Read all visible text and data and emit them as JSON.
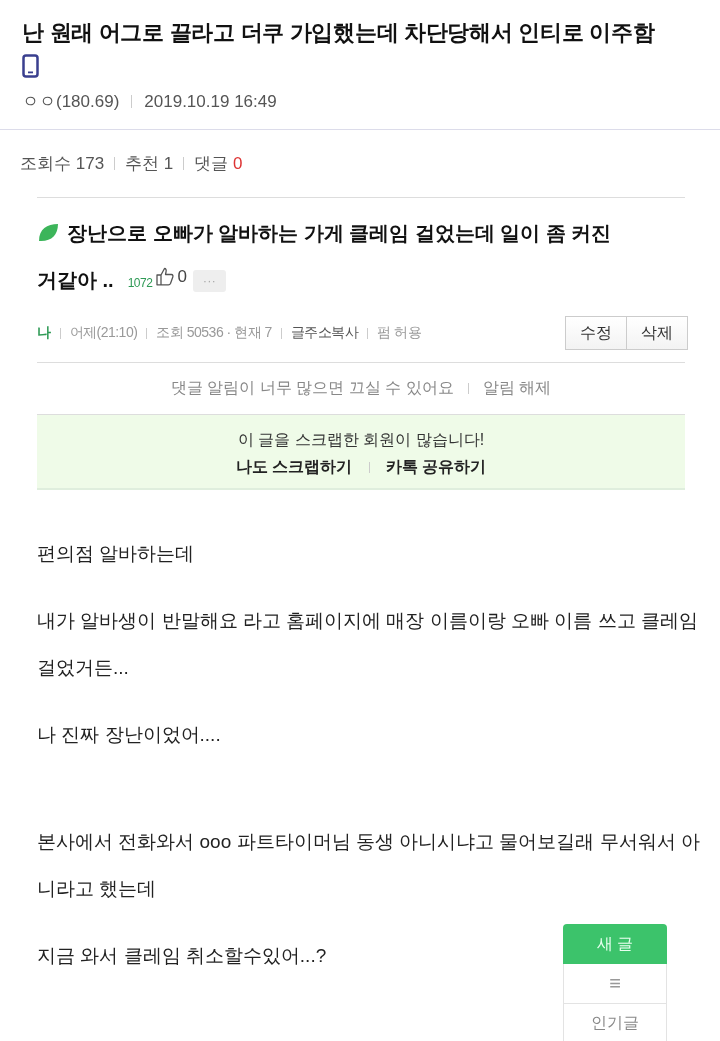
{
  "post": {
    "title": "난 원래 어그로 끌라고 더쿠 가입했는데 차단당해서 인티로 이주함",
    "author": "ㅇㅇ(180.69)",
    "date": "2019.10.19 16:49",
    "stats": [
      {
        "label": "조회수",
        "value": "173",
        "highlight": false
      },
      {
        "label": "추천",
        "value": "1",
        "highlight": false
      },
      {
        "label": "댓글",
        "value": "0",
        "highlight": true
      }
    ]
  },
  "embedded": {
    "title_lines": [
      "장난으로 오빠가 알바하는 가게 클레임 걸었는데 일이 좀 커진",
      "거같아 .."
    ],
    "count": "1072",
    "likes": "0",
    "more": "···",
    "meta": [
      {
        "text": "나",
        "kind": "author"
      },
      {
        "text": "어제(21:10)",
        "kind": "plain"
      },
      {
        "text": "조회 50536 · 현재 7",
        "kind": "plain"
      },
      {
        "text": "글주소복사",
        "kind": "link"
      },
      {
        "text": "펌 허용",
        "kind": "plain"
      }
    ],
    "buttons": [
      "수정",
      "삭제"
    ],
    "notice": {
      "text": "댓글 알림이 너무 많으면 끄실 수 있어요",
      "action": "알림 해제"
    },
    "scrap": {
      "message": "이 글을 스크랩한 회원이 많습니다!",
      "actions": [
        "나도 스크랩하기",
        "카톡 공유하기"
      ]
    }
  },
  "body": [
    {
      "text": "편의점 알바하는데",
      "kind": "normal"
    },
    {
      "text": "내가 알바생이 반말해요 라고 홈페이지에 매장 이름이랑 오빠 이름 쓰고 클레임 걸었거든...",
      "kind": "normal"
    },
    {
      "text": "나 진짜 장난이었어....",
      "kind": "normal"
    },
    {
      "text": "본사에서 전화와서 ooo 파트타이머님 동생 아니시냐고 물어보길래 무서워서 아니라고 했는데",
      "kind": "after-break"
    },
    {
      "text": "지금 와서 클레임 취소할수있어...?",
      "kind": "normal"
    }
  ],
  "float_menu": {
    "new_post": "새 글",
    "menu": "≡",
    "popular": "인기글"
  }
}
